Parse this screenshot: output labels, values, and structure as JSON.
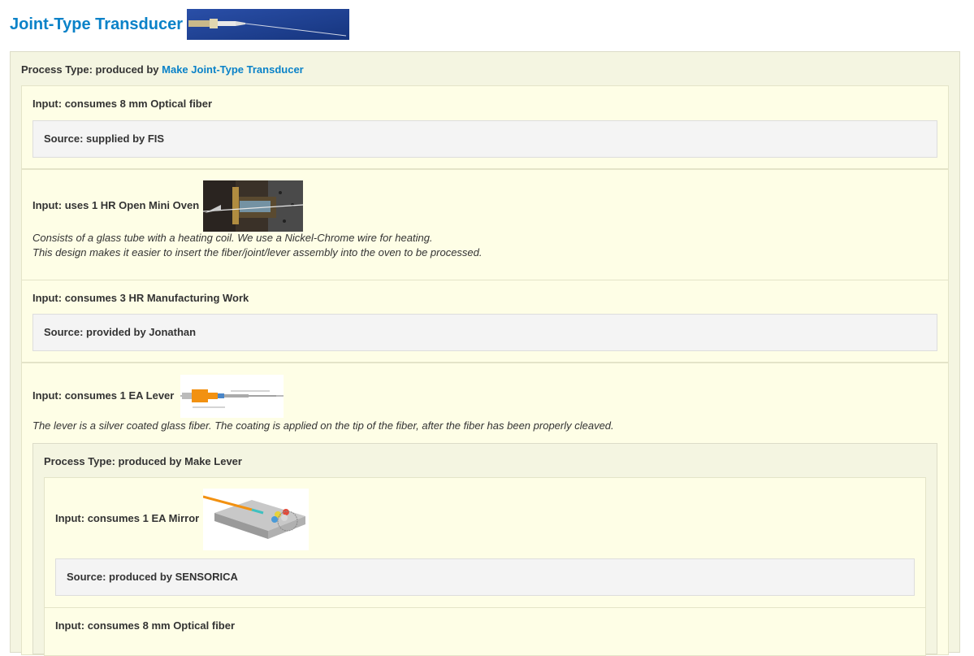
{
  "header": {
    "title": "Joint-Type Transducer",
    "image_name": "transducer-photo"
  },
  "top_process": {
    "prefix": "Process Type: produced by ",
    "link": "Make Joint-Type Transducer"
  },
  "inputs": [
    {
      "label": "Input: consumes 8 mm Optical fiber",
      "source": "Source: supplied by FIS"
    },
    {
      "label": "Input: uses 1 HR Open Mini Oven",
      "image_name": "oven-photo",
      "description_lines": [
        "Consists of a glass tube with a heating coil. We use a Nickel-Chrome wire for heating.",
        "This design makes it easier to insert the fiber/joint/lever assembly into the oven to be processed."
      ]
    },
    {
      "label": "Input: consumes 3 HR Manufacturing Work",
      "source": "Source: provided by Jonathan"
    },
    {
      "label": "Input: consumes 1 EA Lever",
      "image_name": "lever-diagram",
      "description": "The lever is a silver coated glass fiber. The coating is applied on the tip of the fiber, after the fiber has been properly cleaved.",
      "sub_process": {
        "label": "Process Type: produced by Make Lever",
        "inputs": [
          {
            "label": "Input: consumes 1 EA Mirror",
            "image_name": "mirror-render",
            "source": "Source: produced by SENSORICA"
          },
          {
            "label": "Input: consumes 8 mm Optical fiber"
          }
        ]
      }
    }
  ],
  "colors": {
    "link": "#0a82c8",
    "process_bg": "#f4f5e1",
    "input_bg": "#fefee6",
    "source_bg": "#f4f4f4"
  }
}
